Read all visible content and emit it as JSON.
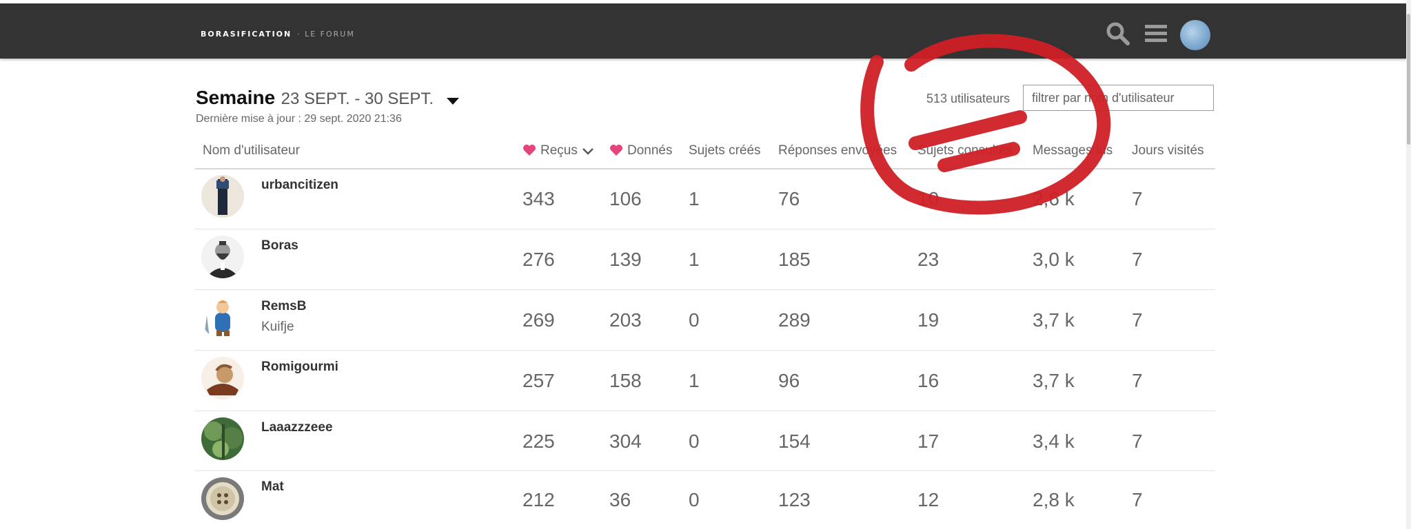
{
  "header": {
    "logo_main": "BORASIFICATION",
    "logo_sub": "· LE FORUM"
  },
  "period": {
    "label": "Semaine",
    "range": "23 SEPT. - 30 SEPT.",
    "updated": "Dernière mise à jour : 29 sept. 2020 21:36"
  },
  "users": {
    "count": "513 utilisateurs",
    "filter_placeholder": "filtrer par nom d'utilisateur"
  },
  "colors": {
    "heart": "#e5457c",
    "annotation": "#d01f26",
    "header_bg": "#333333"
  },
  "table": {
    "columns": {
      "username": "Nom d'utilisateur",
      "received": "Reçus",
      "given": "Donnés",
      "topics": "Sujets créés",
      "replies": "Réponses envoyées",
      "viewed": "Sujets consultés",
      "read": "Messages lus",
      "days": "Jours visités"
    },
    "rows": [
      {
        "username": "urbancitizen",
        "title": "",
        "received": "343",
        "given": "106",
        "topics": "1",
        "replies": "76",
        "viewed": "10",
        "read": "2,6 k",
        "days": "7"
      },
      {
        "username": "Boras",
        "title": "",
        "received": "276",
        "given": "139",
        "topics": "1",
        "replies": "185",
        "viewed": "23",
        "read": "3,0 k",
        "days": "7"
      },
      {
        "username": "RemsB",
        "title": "Kuifje",
        "received": "269",
        "given": "203",
        "topics": "0",
        "replies": "289",
        "viewed": "19",
        "read": "3,7 k",
        "days": "7"
      },
      {
        "username": "Romigourmi",
        "title": "",
        "received": "257",
        "given": "158",
        "topics": "1",
        "replies": "96",
        "viewed": "16",
        "read": "3,7 k",
        "days": "7"
      },
      {
        "username": "Laaazzzeee",
        "title": "",
        "received": "225",
        "given": "304",
        "topics": "0",
        "replies": "154",
        "viewed": "17",
        "read": "3,4 k",
        "days": "7"
      },
      {
        "username": "Mat",
        "title": "",
        "received": "212",
        "given": "36",
        "topics": "0",
        "replies": "123",
        "viewed": "12",
        "read": "2,8 k",
        "days": "7"
      }
    ]
  }
}
